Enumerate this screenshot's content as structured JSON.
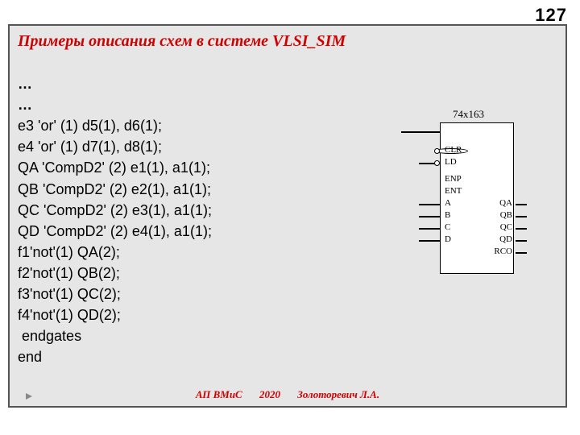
{
  "page_number": "127",
  "title": "Примеры описания схем в системе VLSI_SIM",
  "code_lines": [
    "…",
    "…",
    "e3 'or' (1) d5(1), d6(1);",
    "e4 'or' (1) d7(1), d8(1);",
    "QA 'CompD2' (2) e1(1), a1(1);",
    "QB 'CompD2' (2) e2(1), a1(1);",
    "QC 'CompD2' (2) e3(1), a1(1);",
    "QD 'CompD2' (2) e4(1), a1(1);",
    "f1'not'(1) QA(2);",
    "f2'not'(1) QB(2);",
    "f3'not'(1) QC(2);",
    "f4'not'(1) QD(2);",
    " endgates",
    "end"
  ],
  "chip": {
    "part": "74x163",
    "left_pins": [
      "CLR",
      "LD",
      "ENP",
      "ENT",
      "A",
      "B",
      "C",
      "D"
    ],
    "right_pins": [
      "QA",
      "QB",
      "QC",
      "QD",
      "RCO"
    ]
  },
  "footer": {
    "course": "АП ВМиС",
    "year": "2020",
    "author": "Золоторевич Л.А."
  }
}
